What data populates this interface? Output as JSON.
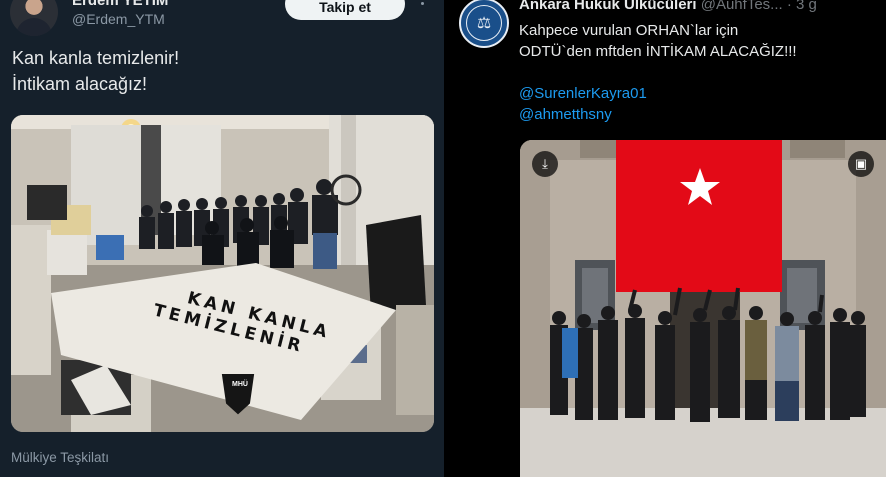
{
  "left_tweet": {
    "author_name": "Erdem YETİM",
    "author_handle": "@Erdem_YTM",
    "follow_label": "Takip et",
    "text_lines": [
      "Kan kanla temizlenir!",
      "İntikam alacağız!"
    ],
    "banner_text": [
      "KAN KANLA",
      "TEMİZLENİR"
    ],
    "banner_emblem": "MHÜ",
    "caption": "Mülkiye Teşkilatı"
  },
  "right_tweet": {
    "author_name": "Ankara Hukuk Ülkücüleri",
    "author_handle": "@AuhfTes...",
    "time": "· 3 g",
    "text_lines": [
      "Kahpece vurulan ORHAN`lar için",
      "ODTÜ`den mftden İNTİKAM ALACAĞIZ!!!",
      ""
    ],
    "mentions": [
      "@SurenlerKayra01",
      "@ahmetthsny"
    ],
    "icons": {
      "download": "download-icon",
      "alt": "image-icon"
    }
  },
  "colors": {
    "left_bg": "#15202b",
    "right_bg": "#000000",
    "mention": "#1d9bf0",
    "flag_red": "#e30a17"
  }
}
